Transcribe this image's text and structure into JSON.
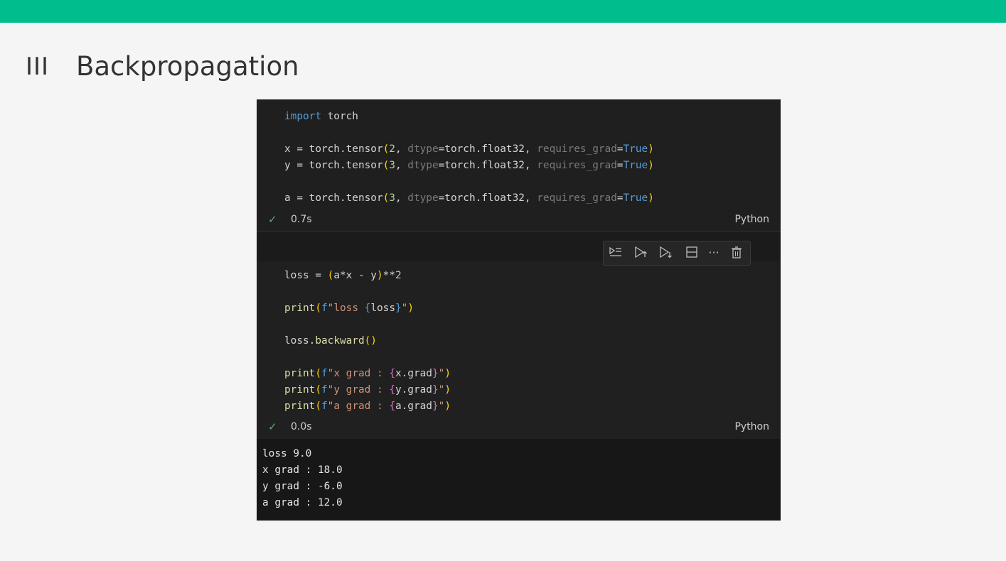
{
  "slide": {
    "number": "III",
    "title": "Backpropagation"
  },
  "cell1": {
    "lines": [
      "import torch",
      "",
      "x = torch.tensor(2, dtype=torch.float32, requires_grad=True)",
      "y = torch.tensor(3, dtype=torch.float32, requires_grad=True)",
      "",
      "a = torch.tensor(3, dtype=torch.float32, requires_grad=True)"
    ],
    "exec_time": "0.7s",
    "language": "Python"
  },
  "toolbar": {
    "icons": [
      "run-by-line-icon",
      "execute-above-icon",
      "execute-below-icon",
      "split-cell-icon",
      "more-icon",
      "delete-icon"
    ]
  },
  "cell2": {
    "lines": [
      "loss = (a*x - y)**2",
      "",
      "print(f\"loss {loss}\")",
      "",
      "loss.backward()",
      "",
      "print(f\"x grad : {x.grad}\")",
      "print(f\"y grad : {y.grad}\")",
      "print(f\"a grad : {a.grad}\")"
    ],
    "exec_time": "0.0s",
    "language": "Python"
  },
  "output": {
    "lines": [
      "loss 9.0",
      "x grad : 18.0",
      "y grad : -6.0",
      "a grad : 12.0"
    ]
  },
  "colors": {
    "accent_bar": "#00bd8e",
    "editor_bg": "#1f1f1f",
    "keyword": "#569cd6",
    "string": "#ce9178",
    "number": "#b5cea8"
  }
}
